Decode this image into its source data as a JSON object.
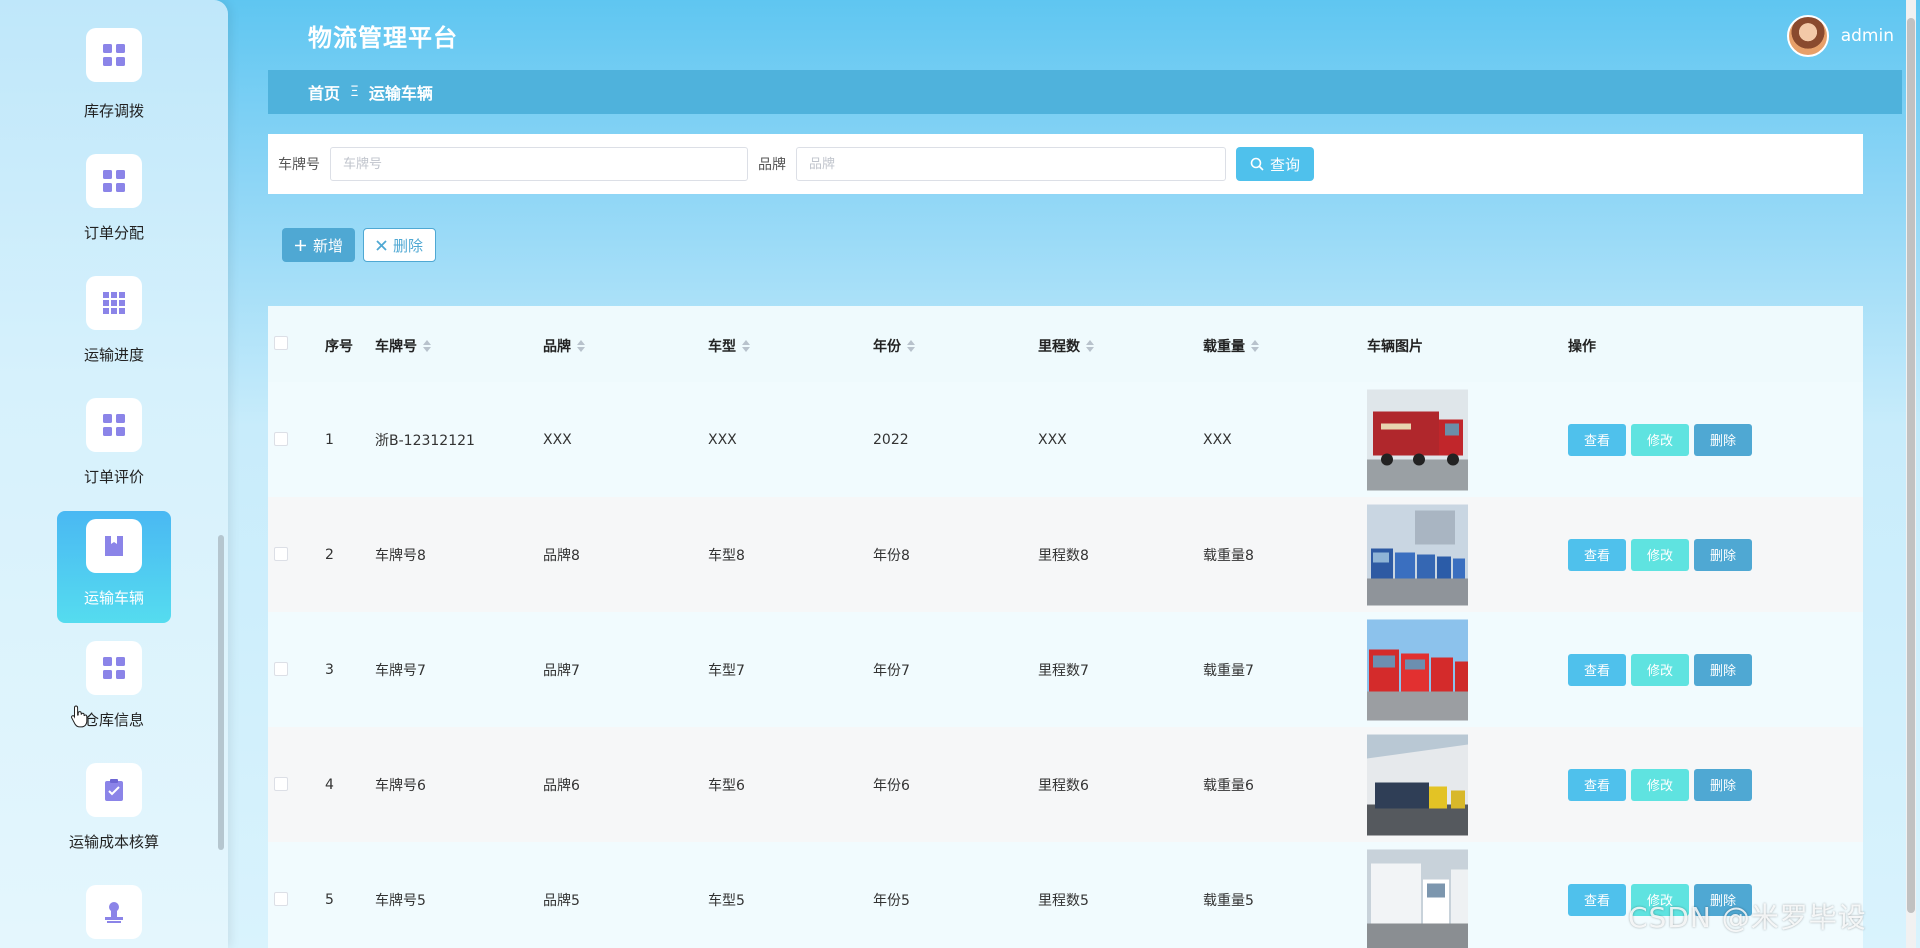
{
  "app": {
    "title": "物流管理平台",
    "username": "admin"
  },
  "breadcrumb": {
    "home": "首页",
    "separator": "Ξ",
    "current": "运输车辆"
  },
  "sidebar": {
    "items": [
      {
        "label": "库存调拨",
        "icon": "grid-icon"
      },
      {
        "label": "订单分配",
        "icon": "grid-icon"
      },
      {
        "label": "运输进度",
        "icon": "grid-9-icon"
      },
      {
        "label": "订单评价",
        "icon": "grid-icon"
      },
      {
        "label": "运输车辆",
        "icon": "book-icon",
        "active": true
      },
      {
        "label": "仓库信息",
        "icon": "grid-icon"
      },
      {
        "label": "运输成本核算",
        "icon": "clipboard-check-icon"
      },
      {
        "label": "",
        "icon": "stamp-icon"
      }
    ]
  },
  "search": {
    "plate_label": "车牌号",
    "plate_placeholder": "车牌号",
    "brand_label": "品牌",
    "brand_placeholder": "品牌",
    "query_label": "查询"
  },
  "actions": {
    "add_label": "新增",
    "delete_label": "删除"
  },
  "table": {
    "headers": {
      "index": "序号",
      "plate": "车牌号",
      "brand": "品牌",
      "model": "车型",
      "year": "年份",
      "mileage": "里程数",
      "load": "载重量",
      "image": "车辆图片",
      "ops": "操作"
    },
    "ops": {
      "view": "查看",
      "edit": "修改",
      "delete": "删除"
    },
    "rows": [
      {
        "index": "1",
        "plate": "浙B-12312121",
        "brand": "XXX",
        "model": "XXX",
        "year": "2022",
        "mileage": "XXX",
        "load": "XXX",
        "image_caption": "货车图片"
      },
      {
        "index": "2",
        "plate": "车牌号8",
        "brand": "品牌8",
        "model": "车型8",
        "year": "年份8",
        "mileage": "里程数8",
        "load": "载重量8"
      },
      {
        "index": "3",
        "plate": "车牌号7",
        "brand": "品牌7",
        "model": "车型7",
        "year": "年份7",
        "mileage": "里程数7",
        "load": "载重量7"
      },
      {
        "index": "4",
        "plate": "车牌号6",
        "brand": "品牌6",
        "model": "车型6",
        "year": "年份6",
        "mileage": "里程数6",
        "load": "载重量6"
      },
      {
        "index": "5",
        "plate": "车牌号5",
        "brand": "品牌5",
        "model": "车型5",
        "year": "年份5",
        "mileage": "里程数5",
        "load": "载重量5"
      }
    ]
  },
  "watermark": "CSDN @米罗毕设",
  "colors": {
    "accent": "#4fc1ec",
    "edit": "#5fe3e0",
    "primary": "#4fa8d3",
    "active_nav": "#4ab8f3"
  }
}
